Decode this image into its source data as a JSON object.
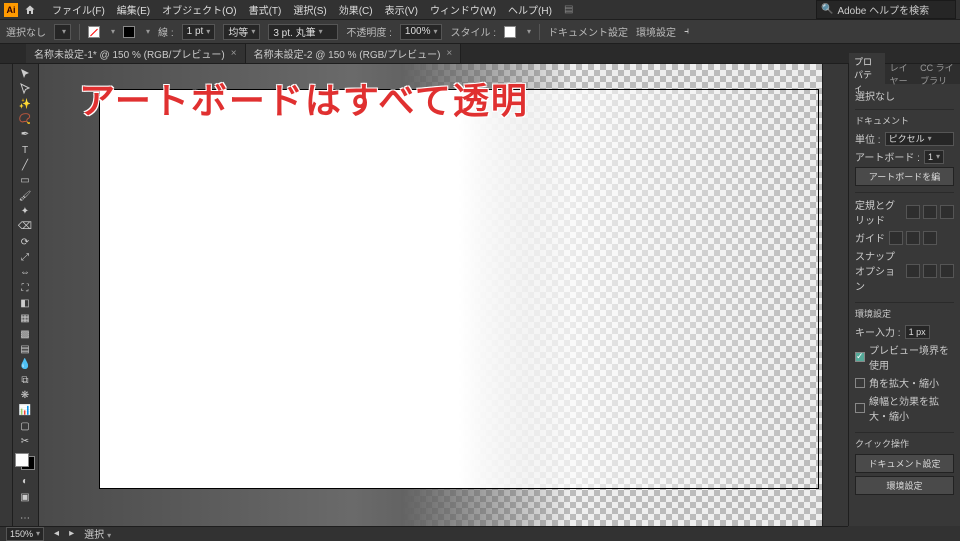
{
  "menubar": {
    "items": [
      "ファイル(F)",
      "編集(E)",
      "オブジェクト(O)",
      "書式(T)",
      "選択(S)",
      "効果(C)",
      "表示(V)",
      "ウィンドウ(W)",
      "ヘルプ(H)"
    ],
    "search_placeholder": "Adobe ヘルプを検索"
  },
  "ctrlbar": {
    "no_selection": "選択なし",
    "stroke_label": "線 :",
    "stroke_width": "1 pt",
    "uniform": "均等",
    "brush_size": "3 pt. 丸筆",
    "opacity_label": "不透明度 :",
    "opacity_value": "100%",
    "style_label": "スタイル :",
    "doc_setup": "ドキュメント設定",
    "env_setup": "環境設定"
  },
  "tabs": [
    {
      "label": "名称未設定-1* @ 150 % (RGB/プレビュー)",
      "active": false
    },
    {
      "label": "名称未設定-2 @ 150 % (RGB/プレビュー)",
      "active": true
    }
  ],
  "overlay": "アートボードはすべて透明",
  "panels": {
    "tabs": [
      "プロパティ",
      "レイヤー",
      "CC ライブラリ"
    ],
    "no_selection": "選択なし",
    "doc_header": "ドキュメント",
    "unit_label": "単位 :",
    "unit_value": "ピクセル",
    "artboard_label": "アートボード :",
    "artboard_value": "1",
    "edit_artboards": "アートボードを編",
    "ruler_grid": "定規とグリッド",
    "guides": "ガイド",
    "snap_options": "スナップオプション",
    "env_header": "環境設定",
    "key_input": "キー入力 :",
    "key_value": "1 px",
    "cb1": "プレビュー境界を使用",
    "cb2": "角を拡大・縮小",
    "cb3": "線幅と効果を拡大・縮小",
    "quick_header": "クイック操作",
    "btn_doc": "ドキュメント設定",
    "btn_env": "環境設定"
  },
  "status": {
    "zoom": "150%",
    "mode": "選択"
  }
}
